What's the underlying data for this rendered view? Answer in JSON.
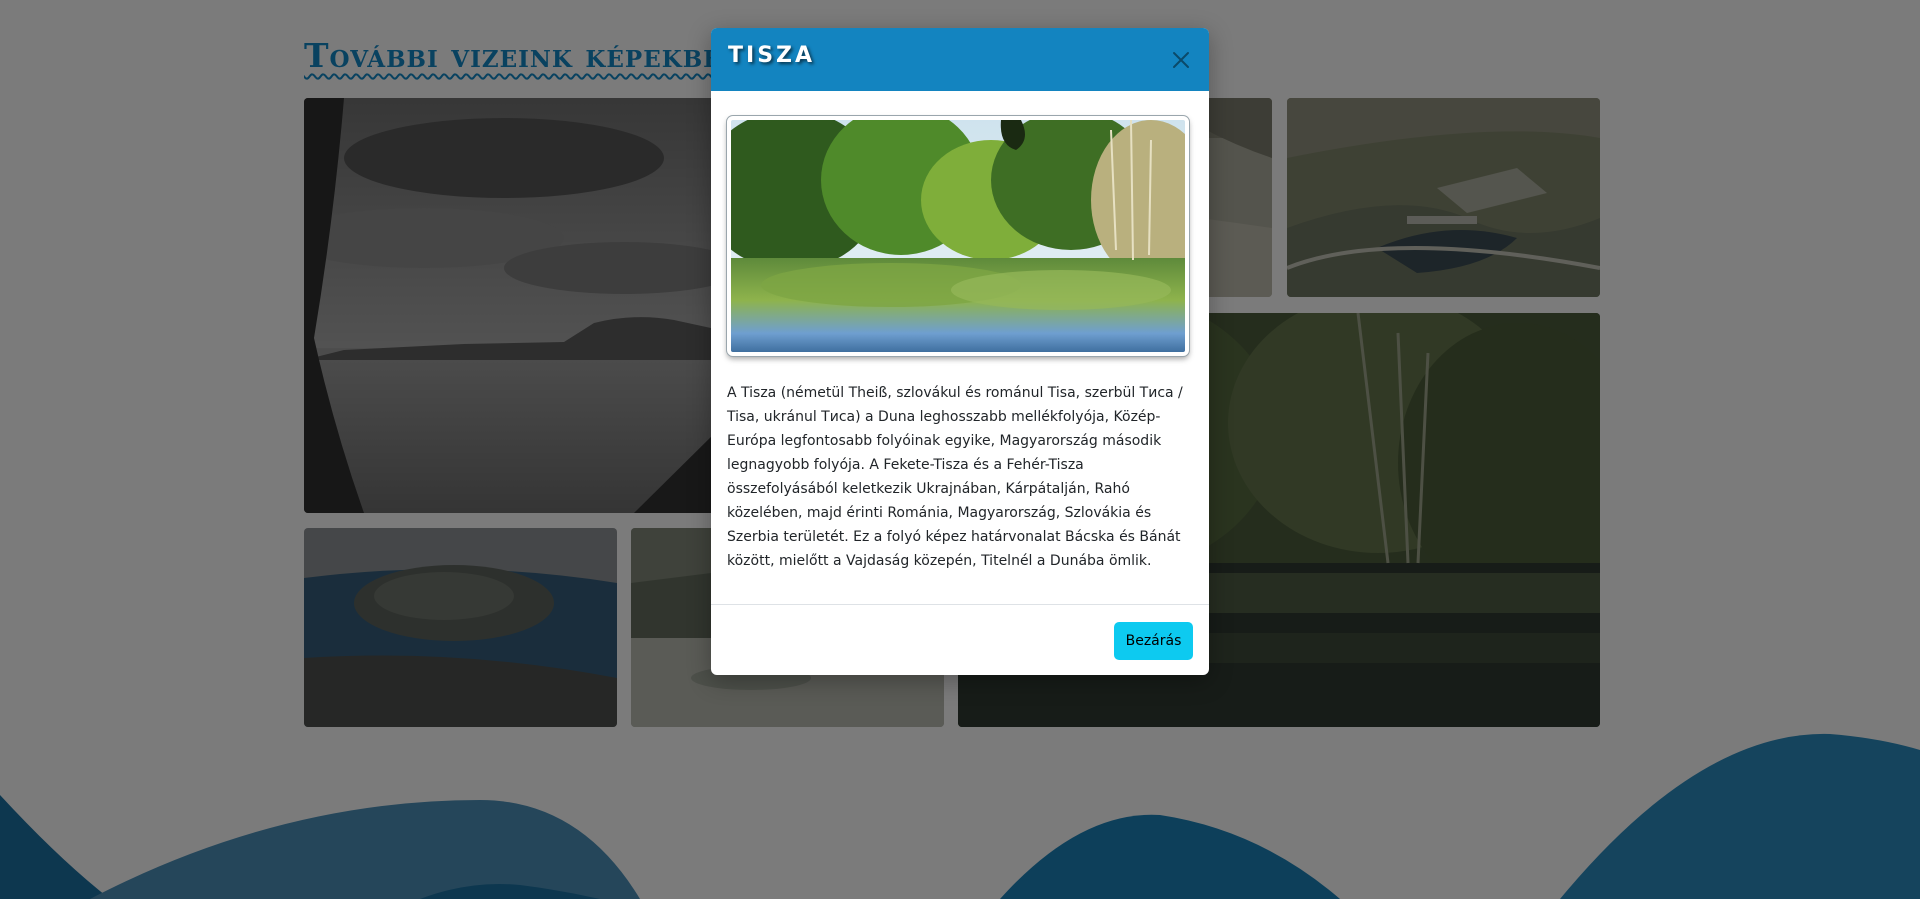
{
  "page": {
    "section_title": "További vizeink képekben",
    "colors": {
      "accent": "#1384c0",
      "close_button": "#0dcaf0",
      "wave": "#1a7fb4"
    }
  },
  "gallery": {
    "tiles": [
      {
        "name": "balaton-landscape-photo"
      },
      {
        "name": "river-aerial-photo"
      },
      {
        "name": "dam-aerial-photo"
      },
      {
        "name": "island-aerial-photo"
      },
      {
        "name": "wetland-photo"
      },
      {
        "name": "tisza-river-photo"
      }
    ]
  },
  "modal": {
    "title": "TISZA",
    "close_icon": "close-icon",
    "image": "tisza-river-photo",
    "description": "A Tisza (németül Theiß, szlovákul és románul Tisa, szerbül Тиса / Tisa, ukránul Тиса) a Duna leghosszabb mellékfolyója, Közép-Európa legfontosabb folyóinak egyike, Magyarország második legnagyobb folyója. A Fekete-Tisza és a Fehér-Tisza összefolyásából keletkezik Ukrajnában, Kárpátalján, Rahó közelében, majd érinti Románia, Magyarország, Szlovákia és Szerbia területét. Ez a folyó képez határvonalat Bácska és Bánát között, mielőtt a Vajdaság közepén, Titelnél a Dunába ömlik.",
    "close_button_label": "Bezárás"
  }
}
